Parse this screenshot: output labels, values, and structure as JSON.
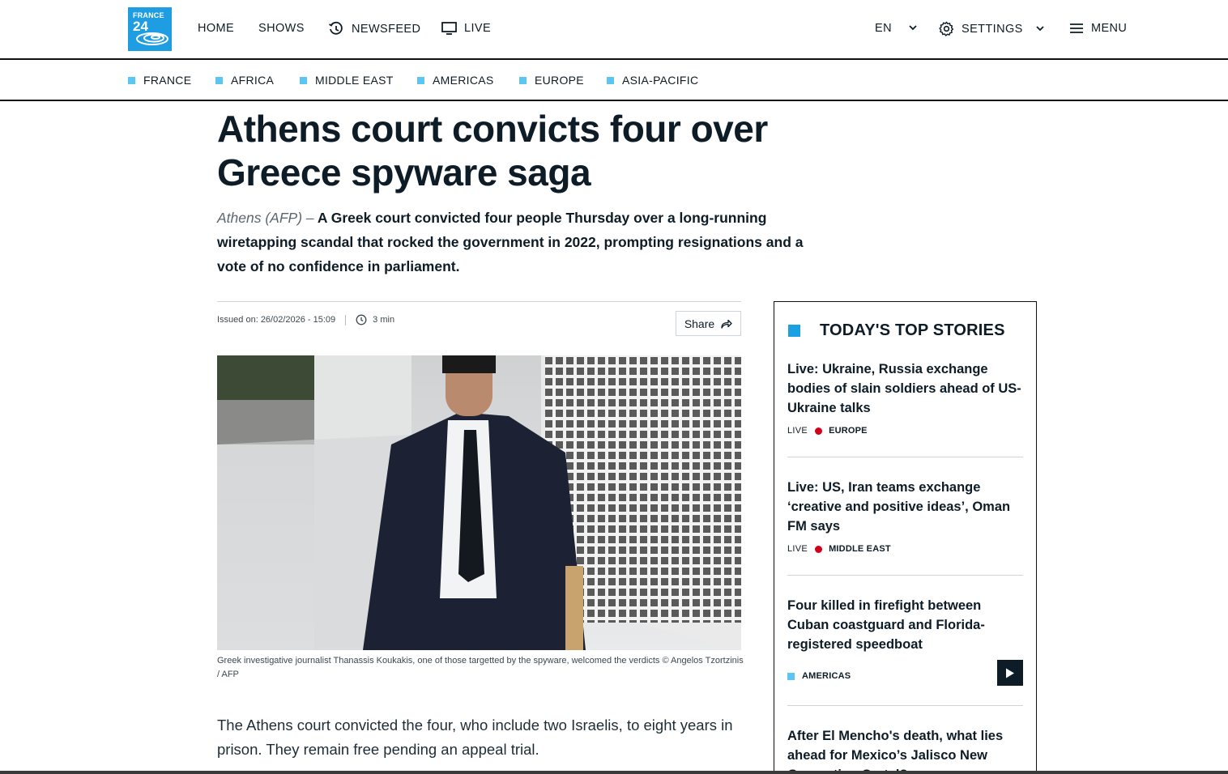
{
  "header": {
    "logo_line1": "FRANCE",
    "logo_line2": "24",
    "nav": {
      "home": "HOME",
      "shows": "SHOWS",
      "newsfeed": "NEWSFEED",
      "live": "LIVE",
      "language": "EN",
      "settings": "SETTINGS",
      "menu": "MENU"
    }
  },
  "regions": [
    "FRANCE",
    "AFRICA",
    "MIDDLE EAST",
    "AMERICAS",
    "EUROPE",
    "ASIA-PACIFIC"
  ],
  "article": {
    "headline": "Athens court convicts four over Greece spyware saga",
    "dateline": "Athens (AFP) –",
    "lead": "A Greek court convicted four people Thursday over a long-running wiretapping scandal that rocked the government in 2022, prompting resignations and a vote of no confidence in parliament.",
    "issued": "Issued on: 26/02/2026 - 15:09",
    "read_time": "3 min",
    "share_label": "Share",
    "caption": "Greek investigative journalist Thanassis Koukakis, one of those targetted by the spyware, welcomed the verdicts © Angelos Tzortzinis / AFP",
    "body_first_paragraph": "The Athens court convicted the four, who include two Israelis, to eight years in prison. They remain free pending an appeal trial."
  },
  "sidebar": {
    "title": "TODAY'S TOP STORIES",
    "stories": [
      {
        "title": "Live: Ukraine, Russia exchange bodies of slain soldiers ahead of US-Ukraine talks",
        "live_label": "LIVE",
        "section": "EUROPE"
      },
      {
        "title": "Live: US, Iran teams exchange ‘creative and positive ideas’, Oman FM says",
        "live_label": "LIVE",
        "section": "MIDDLE EAST"
      },
      {
        "title": "Four killed in firefight between Cuban coastguard and Florida-registered speedboat",
        "section": "AMERICAS"
      },
      {
        "title": "After El Mencho's death, what lies ahead for Mexico’s Jalisco New Generation Cartel?"
      }
    ]
  },
  "colors": {
    "brand_blue": "#1f9de3",
    "region_square": "#5cc6f2",
    "live_dot": "#d0021b",
    "text_dark": "#0d1c26"
  },
  "icons": {
    "newsfeed": "history-icon",
    "live": "monitor-icon",
    "settings": "gear-icon",
    "menu": "hamburger-icon",
    "share": "share-arrow-icon",
    "read_time": "clock-icon",
    "video": "play-icon"
  }
}
